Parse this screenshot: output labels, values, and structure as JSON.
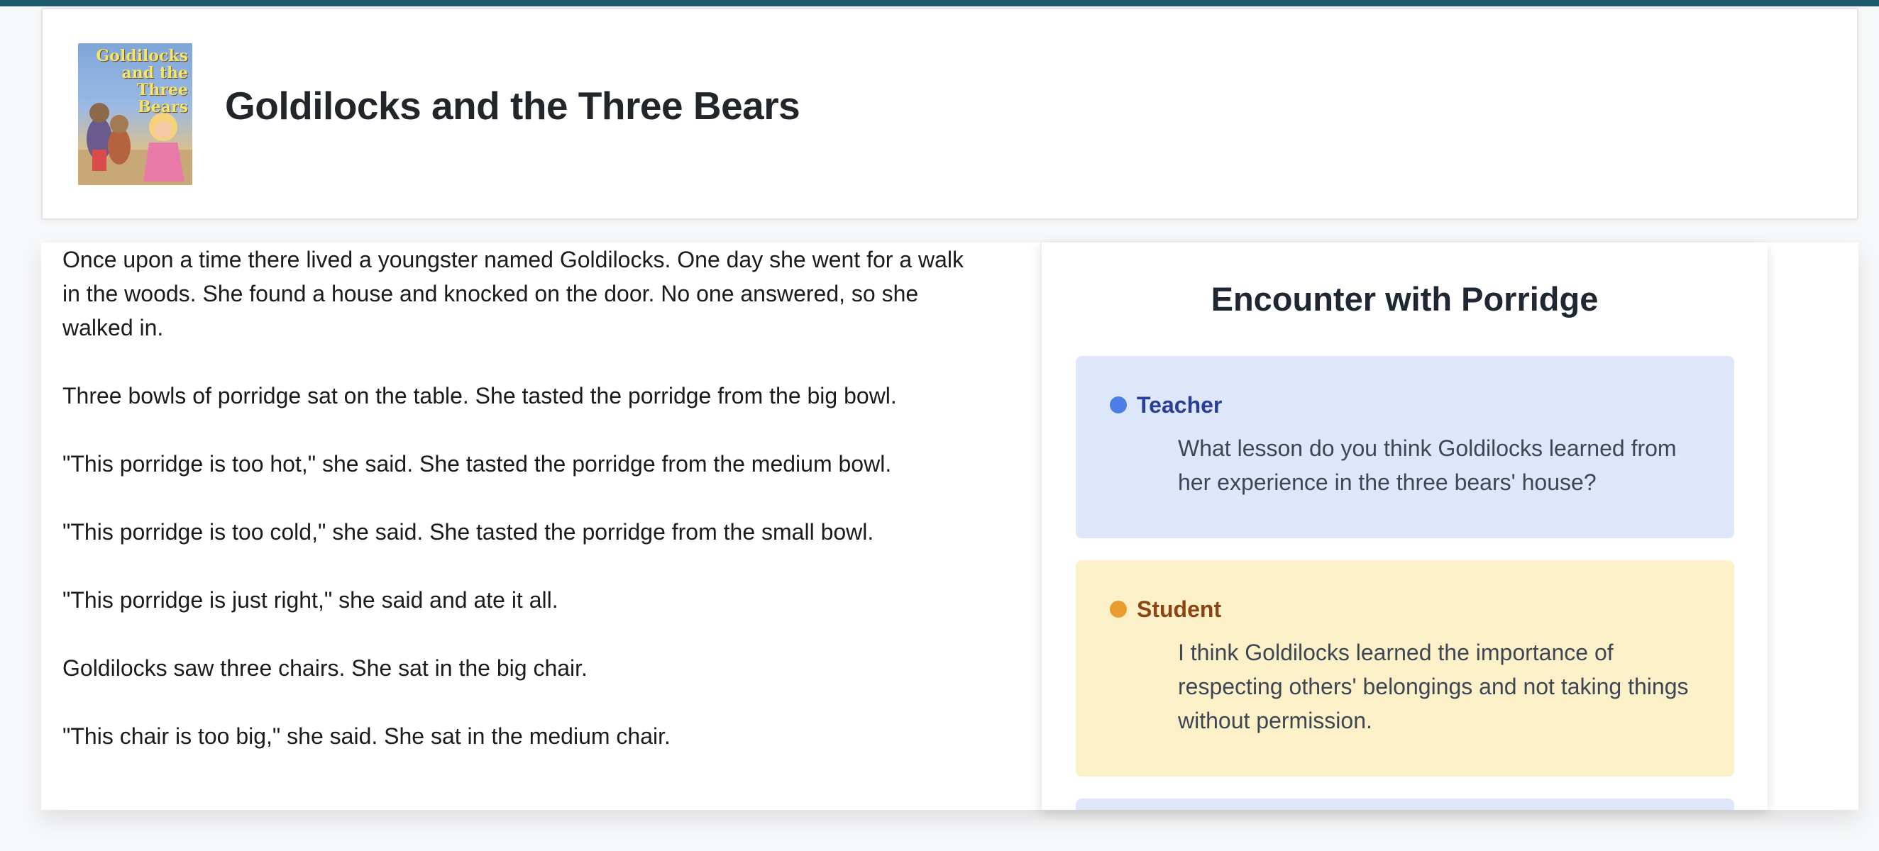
{
  "header": {
    "cover_alt_title": "Goldilocks and the Three Bears",
    "title": "Goldilocks and the Three Bears"
  },
  "story": {
    "paragraphs": [
      "Once upon a time there lived a youngster named Goldilocks. One day she went for a walk in the woods. She found a house and knocked on the door. No one answered, so she walked in.",
      "Three bowls of porridge sat on the table. She tasted the porridge from the big bowl.",
      "\"This porridge is too hot,\" she said. She tasted the porridge from the medium bowl.",
      "\"This porridge is too cold,\" she said. She tasted the porridge from the small bowl.",
      "\"This porridge is just right,\" she said and ate it all.",
      "Goldilocks saw three chairs. She sat in the big chair.",
      "\"This chair is too big,\" she said. She sat in the medium chair."
    ]
  },
  "panel": {
    "title": "Encounter with Porridge",
    "messages": [
      {
        "role": "Teacher",
        "text": "What lesson do you think Goldilocks learned from her experience in the three bears' house?"
      },
      {
        "role": "Student",
        "text": "I think Goldilocks learned the importance of respecting others' belongings and not taking things without permission."
      }
    ]
  },
  "colors": {
    "top_bar": "#1f5a6b",
    "teacher_bg": "#dde7f9",
    "student_bg": "#fcf0c8",
    "teacher_dot": "#4d7ee8",
    "student_dot": "#e99c32"
  }
}
